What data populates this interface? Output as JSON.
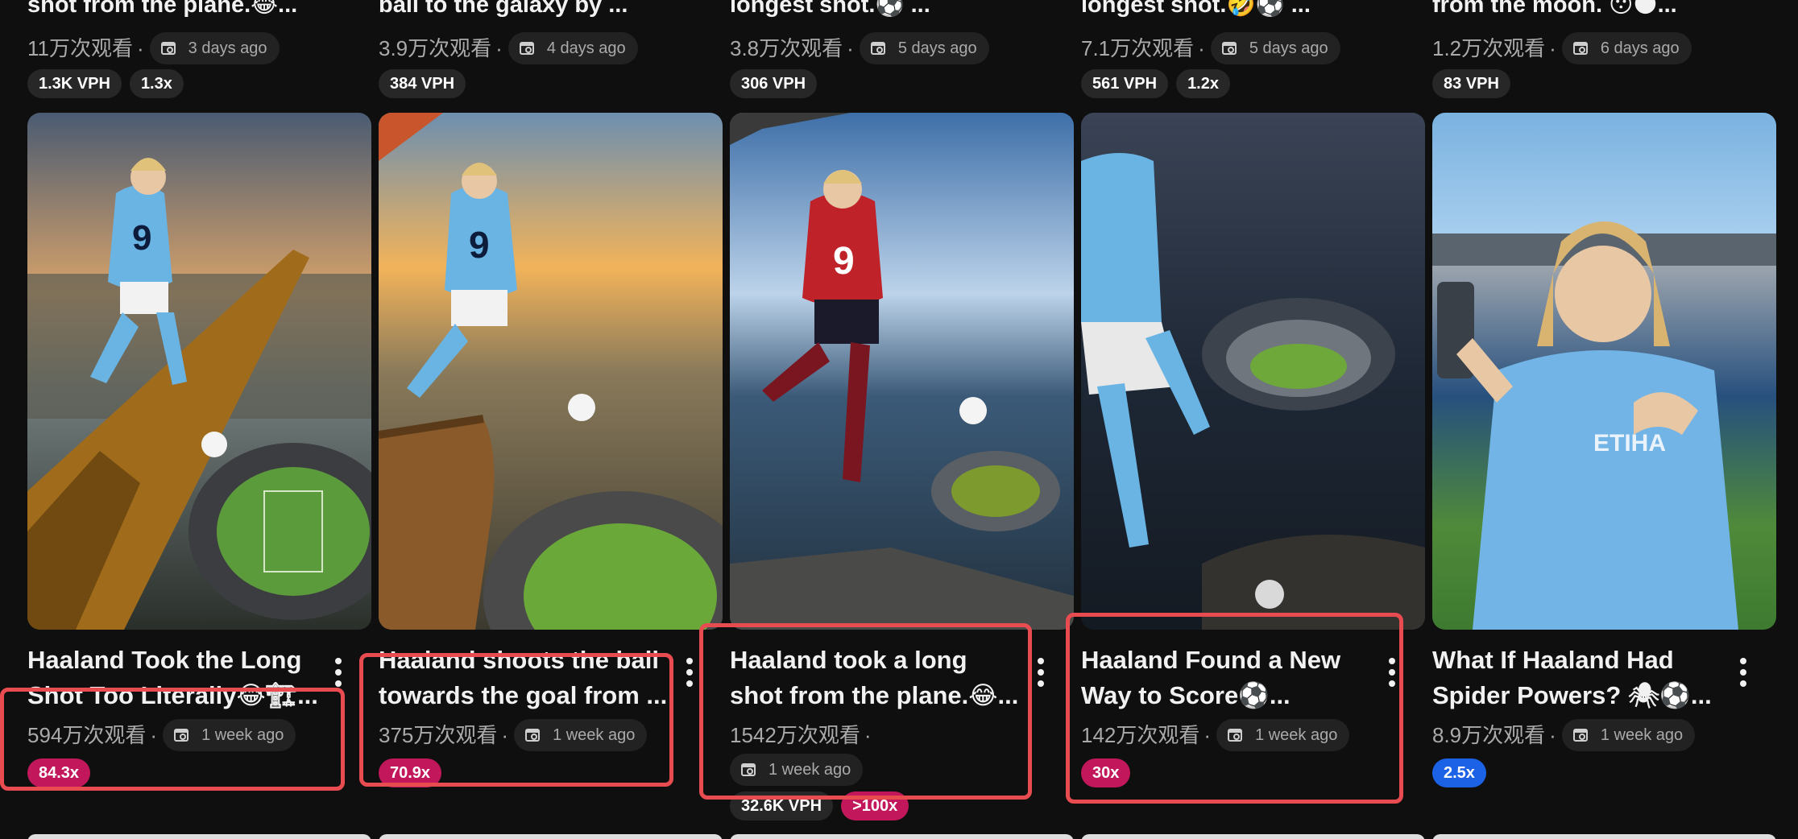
{
  "colors": {
    "background": "#0f0f0f",
    "highlight": "#e84b50",
    "badge_red": "#c2185b",
    "badge_blue": "#1c62e6"
  },
  "top_row": [
    {
      "title": "shot from the plane.😂...",
      "views": "11万次观看",
      "date": "3 days ago",
      "badges": [
        "1.3K VPH",
        "1.3x"
      ]
    },
    {
      "title": "ball to the galaxy by ...",
      "views": "3.9万次观看",
      "date": "4 days ago",
      "badges": [
        "384 VPH"
      ]
    },
    {
      "title": "longest shot.⚽ ...",
      "views": "3.8万次观看",
      "date": "5 days ago",
      "badges": [
        "306 VPH"
      ]
    },
    {
      "title": "longest shot.🤣⚽ ...",
      "views": "7.1万次观看",
      "date": "5 days ago",
      "badges": [
        "561 VPH",
        "1.2x"
      ]
    },
    {
      "title": "from the moon. 😯🌑...",
      "views": "1.2万次观看",
      "date": "6 days ago",
      "badges": [
        "83 VPH"
      ]
    }
  ],
  "cards": [
    {
      "title_line1": "Haaland Took the Long",
      "title_line2": "Shot Too Literally😂🏗...",
      "views": "594万次观看",
      "date": "1 week ago",
      "badges": [
        "84.3x"
      ],
      "thumb_icon": "thumbnail-crane-kick"
    },
    {
      "title_line1": "Haaland shoots the ball",
      "title_line2": "towards the goal from ...",
      "views": "375万次观看",
      "date": "1 week ago",
      "badges": [
        "70.9x"
      ],
      "thumb_icon": "thumbnail-balloon-kick"
    },
    {
      "title_line1": "Haaland took a long",
      "title_line2": "shot from the plane.😂...",
      "views": "1542万次观看",
      "date": "1 week ago",
      "badges": [
        "32.6K VPH",
        ">100x"
      ],
      "thumb_icon": "thumbnail-plane-kick"
    },
    {
      "title_line1": "Haaland Found a New",
      "title_line2": "Way to Score⚽...",
      "views": "142万次观看",
      "date": "1 week ago",
      "badges": [
        "30x"
      ],
      "thumb_icon": "thumbnail-cliff-kick"
    },
    {
      "title_line1": "What If Haaland Had",
      "title_line2": "Spider Powers? 🕷⚽...",
      "views": "8.9万次观看",
      "date": "1 week ago",
      "badges": [
        "2.5x"
      ],
      "thumb_icon": "thumbnail-selfie-stadium"
    }
  ]
}
